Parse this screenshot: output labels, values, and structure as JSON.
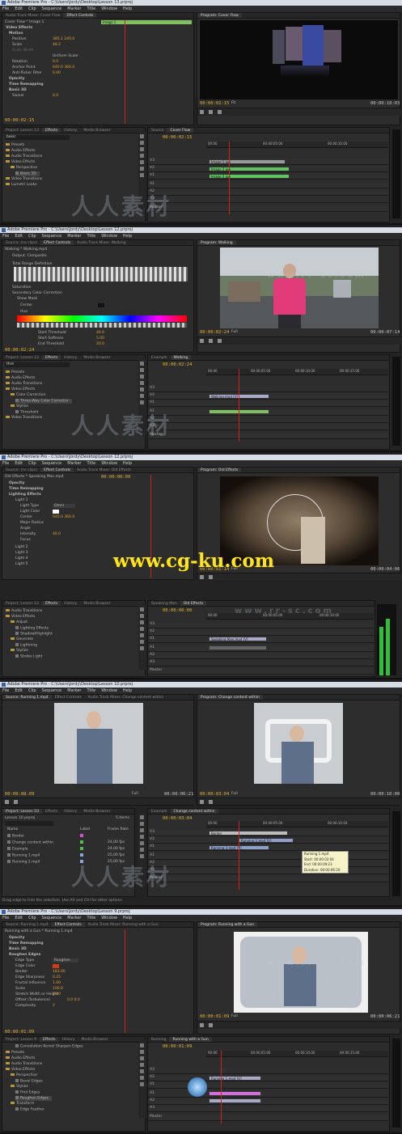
{
  "watermark_top": "www.cg-ku.com",
  "watermark_cn": "人人素材",
  "watermark_url": "www.rr-sc.com",
  "menu": [
    "File",
    "Edit",
    "Clip",
    "Sequence",
    "Marker",
    "Title",
    "Window",
    "Help"
  ],
  "shots": [
    {
      "title": "Adobe Premiere Pro - C:\\Users\\Jordy\\Desktop\\Lesson 13.prproj",
      "ec_tabs": [
        "Audio Track Mixer: Cover Flow",
        "Effect Controls"
      ],
      "ec_clip": "Cover Flow * Image 1",
      "ec_rows": [
        "Video Effects",
        "Motion",
        "Position",
        "Scale",
        "Scale Width",
        "Uniform Scale",
        "Rotation",
        "Anchor Point",
        "Anti-flicker Filter",
        "Opacity",
        "Time Remapping",
        "Basic 3D",
        "Swivel"
      ],
      "ec_vals": [
        "",
        "",
        "385.2  240.0",
        "48.2",
        "",
        "",
        "0.0",
        "640.0  360.0",
        "0.00",
        "",
        "",
        "",
        "0.0"
      ],
      "ec_timecode": "00:00:02:15",
      "program_tab": "Program: Cover Flow",
      "program_tc_left": "00:00:02:15",
      "program_tc_right": "00:00:10:03",
      "fit": "Fit",
      "project_tabs": [
        "Project: Lesson 13",
        "Effects",
        "History",
        "Media Browser"
      ],
      "project_search": "basic",
      "project_items": [
        "Presets",
        "Audio Effects",
        "Audio Transitions",
        "Video Effects",
        "Perspective",
        "Basic 3D",
        "Video Transitions",
        "Lumetri Looks"
      ],
      "seq_tabs": [
        "Source",
        "Cover Flow"
      ],
      "seq_tc": "00:00:02:15",
      "ruler_marks": [
        "00:00",
        "00:00:05:00",
        "00:00:10:00"
      ],
      "tracks_v": [
        "V3",
        "V2",
        "V1"
      ],
      "tracks_a": [
        "A1",
        "A2",
        "A3",
        "Master"
      ],
      "clips": [
        "Image 1.jpg",
        "Image 2.jpg",
        "Image 3.jpg"
      ]
    },
    {
      "title": "Adobe Premiere Pro - C:\\Users\\Jordy\\Desktop\\Lesson 12.prproj",
      "ec_tabs": [
        "Source: (no clips)",
        "Effect Controls",
        "Audio Track Mixer: Walking"
      ],
      "ec_clip": "Walking * Walking.mp4",
      "ec_rows": [
        "Output: Composite",
        "Total Range Definition",
        "Saturation",
        "Secondary Color Correction",
        "Show Mask",
        "Center",
        "Hue",
        "Start Threshold",
        "Start Softness",
        "End Threshold"
      ],
      "ec_vals": [
        "",
        "",
        "",
        "",
        "",
        "",
        "",
        "40.0",
        "5.00",
        "20.0"
      ],
      "ec_timecode": "00:00:02:24",
      "program_tab": "Program: Walking",
      "program_tc_left": "00:00:02:24",
      "program_tc_right": "00:00:07:14",
      "fit": "Full",
      "project_tabs": [
        "Project: Lesson 12",
        "Effects",
        "History",
        "Media Browser"
      ],
      "project_search": "thre",
      "project_items": [
        "Presets",
        "Audio Effects",
        "Audio Transitions",
        "Video Effects",
        "Color Correction",
        "Three-Way Color Corrector",
        "Stylize",
        "Threshold",
        "Video Transitions"
      ],
      "seq_tabs": [
        "Example",
        "Walking"
      ],
      "seq_tc": "00:00:02:24",
      "ruler_marks": [
        "00:00",
        "00:00:05:00",
        "00:00:10:00",
        "00:00:15:00"
      ],
      "tracks_v": [
        "V3",
        "V2",
        "V1"
      ],
      "tracks_a": [
        "A1",
        "A2",
        "A3",
        "Master"
      ],
      "clips": [
        "Walking.mp4 [V]"
      ]
    },
    {
      "title": "Adobe Premiere Pro - C:\\Users\\Jordy\\Desktop\\Lesson 12.prproj",
      "ec_tabs": [
        "Source: (no clips)",
        "Effect Controls",
        "Audio Track Mixer: Old Effects"
      ],
      "ec_clip": "Old Effects * Speaking Man.mp4",
      "ec_rows": [
        "Opacity",
        "Time Remapping",
        "Lighting Effects",
        "Light 1",
        "Light Type",
        "Light Color",
        "Center",
        "Major Radius",
        "Angle",
        "Intensity",
        "Focus",
        "Light 2",
        "Light 3",
        "Light 4",
        "Light 5"
      ],
      "ec_vals": [
        "",
        "",
        "",
        "",
        "Omni",
        "",
        "640.0  360.0",
        "",
        "",
        "46.0",
        "",
        "",
        "",
        "",
        ""
      ],
      "ec_timecode": "00:00:00:00",
      "program_tab": "Program: Old Effects",
      "program_tc_left": "00:00:01:14",
      "program_tc_right": "00:00:04:06",
      "fit": "Full",
      "project_tabs": [
        "Project: Lesson 12",
        "Effects",
        "History",
        "Media Browser"
      ],
      "project_search": "",
      "project_items": [
        "Audio Transitions",
        "Video Effects",
        "Adjust",
        "Lighting Effects",
        "Shadow/Highlight",
        "Generate",
        "Lightning",
        "Stylize",
        "Strobe Light"
      ],
      "seq_tabs": [
        "Speaking Man",
        "Old Effects"
      ],
      "seq_tc": "00:00:00:00",
      "ruler_marks": [
        "00:00",
        "00:00:05:00",
        "00:00:10:00"
      ],
      "tracks_v": [
        "V3",
        "V2",
        "V1"
      ],
      "tracks_a": [
        "A1",
        "A2",
        "A3",
        "Master"
      ],
      "clips": [
        "Speaking Man.mp4 [V]"
      ]
    },
    {
      "title": "Adobe Premiere Pro - C:\\Users\\Jordy\\Desktop\\Lesson 10.prproj",
      "src_tab": "Source: Running 1.mp4",
      "src_tc_left": "00:00:08:09",
      "src_tc_right": "00:00:06:21",
      "ec_tabs": [
        "Effect Controls",
        "Audio Track Mixer: Change content within"
      ],
      "program_tab": "Program: Change content within",
      "program_tc_left": "00:00:03:04",
      "program_tc_right": "00:00:10:00",
      "fit": "Full",
      "project_tabs": [
        "Project: Lesson 10",
        "Effects",
        "History",
        "Media Browser"
      ],
      "project_file": "Lesson 10.prproj",
      "project_count": "5 Items",
      "project_cols": [
        "Name",
        "Label",
        "Frame Rate"
      ],
      "project_rows": [
        [
          "Border",
          "",
          ""
        ],
        [
          "Change content within",
          "",
          "24,00 fps"
        ],
        [
          "Example",
          "",
          "24,00 fps"
        ],
        [
          "Running 1.mp4",
          "",
          "25,00 fps"
        ],
        [
          "Running 2.mp4",
          "",
          "25,00 fps"
        ]
      ],
      "seq_tabs": [
        "Example",
        "Change content within"
      ],
      "seq_tc": "00:00:03:04",
      "ruler_marks": [
        "00:00",
        "00:00:05:00",
        "00:00:10:00"
      ],
      "tracks_v": [
        "V3",
        "V2",
        "V1"
      ],
      "tracks_a": [
        "A1",
        "A2",
        "A3",
        "Master"
      ],
      "clips": [
        "Border",
        "Running 1.mp4 [V]",
        "Running 2.mp4 [V]"
      ],
      "tooltip": [
        "Running 1.mp4",
        "Start: 00:00:03:04",
        "End: 00:00:09:23",
        "Duration: 00:00:06:20"
      ],
      "status": "Drag edge to trim the selection. Use Alt and Ctrl for other options."
    },
    {
      "title": "Adobe Premiere Pro - C:\\Users\\Jordy\\Desktop\\Lesson 9.prproj",
      "ec_tabs": [
        "Source: Running 1.mp4",
        "Effect Controls",
        "Audio Track Mixer: Running with a Gun"
      ],
      "ec_clip": "Running with a Gun * Running 1.mp4",
      "ec_rows": [
        "Opacity",
        "Time Remapping",
        "Basic 3D",
        "Roughen Edges",
        "Edge Type",
        "Edge Color",
        "Border",
        "Edge Sharpness",
        "Fractal Influence",
        "Scale",
        "Stretch Width or Height",
        "Offset (Turbulence)",
        "Complexity"
      ],
      "ec_vals": [
        "",
        "",
        "",
        "",
        "Roughen",
        "",
        "183.00",
        "0.25",
        "1.00",
        "100.0",
        "0.00",
        "0.0  0.0",
        "2"
      ],
      "ec_timecode": "00:00:01:09",
      "program_tab": "Program: Running with a Gun",
      "program_tc_left": "00:00:01:09",
      "program_tc_right": "00:00:06:21",
      "fit": "Full",
      "project_tabs": [
        "Project: Lesson 9",
        "Effects",
        "History",
        "Media Browser"
      ],
      "project_search": "",
      "project_items": [
        "Convolution Kernel Sharpen Edges",
        "Presets",
        "Audio Effects",
        "Audio Transitions",
        "Video Effects",
        "Perspective",
        "Bevel Edges",
        "Stylize",
        "Find Edges",
        "Roughen Edges",
        "Transform",
        "Edge Feather"
      ],
      "seq_tabs": [
        "Running",
        "Running with a Gun"
      ],
      "seq_tc": "00:00:01:09",
      "ruler_marks": [
        "00:00",
        "00:00:05:00",
        "00:00:10:00",
        "00:00:15:00"
      ],
      "tracks_v": [
        "V3",
        "V2",
        "V1"
      ],
      "tracks_a": [
        "A1",
        "A2",
        "A3",
        "Master"
      ],
      "clips": [
        "Running 1.mp4 [V]",
        "",
        ""
      ]
    }
  ]
}
